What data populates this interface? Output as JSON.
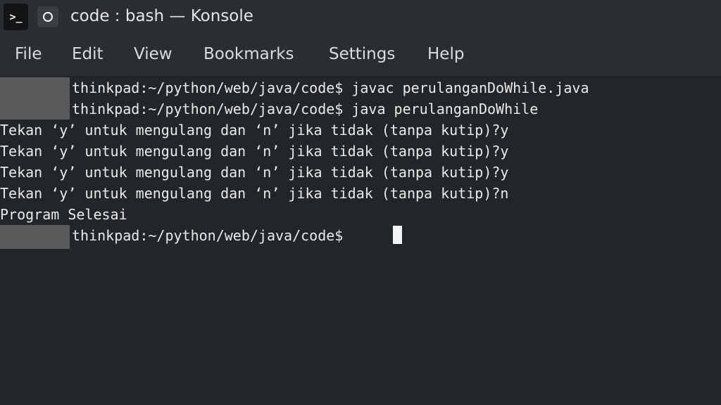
{
  "window": {
    "title": "code : bash — Konsole",
    "app_icon_glyph": ">_",
    "icons": [
      "terminal-app-icon",
      "pin-icon"
    ]
  },
  "menubar": {
    "items": [
      {
        "label": "File"
      },
      {
        "label": "Edit"
      },
      {
        "label": "View"
      },
      {
        "label": "Bookmarks"
      },
      {
        "label": "Settings"
      },
      {
        "label": "Help"
      }
    ]
  },
  "terminal": {
    "lines": [
      {
        "text": "thinkpad:~/python/web/java/code$ javac perulanganDoWhile.java",
        "redacted_prefix": true
      },
      {
        "text": "thinkpad:~/python/web/java/code$ java perulanganDoWhile",
        "redacted_prefix": true
      },
      {
        "text": "Tekan ‘y’ untuk mengulang dan ‘n’ jika tidak (tanpa kutip)?y",
        "redacted_prefix": false
      },
      {
        "text": "Tekan ‘y’ untuk mengulang dan ‘n’ jika tidak (tanpa kutip)?y",
        "redacted_prefix": false
      },
      {
        "text": "Tekan ‘y’ untuk mengulang dan ‘n’ jika tidak (tanpa kutip)?y",
        "redacted_prefix": false
      },
      {
        "text": "Tekan ‘y’ untuk mengulang dan ‘n’ jika tidak (tanpa kutip)?n",
        "redacted_prefix": false
      },
      {
        "text": "Program Selesai",
        "redacted_prefix": false
      },
      {
        "text": "thinkpad:~/python/web/java/code$ ",
        "redacted_prefix": true
      }
    ],
    "colors": {
      "background": "#232629",
      "text": "#eaeaea",
      "redaction": "#5a5a5c",
      "cursor": "#f4f4f4"
    }
  }
}
